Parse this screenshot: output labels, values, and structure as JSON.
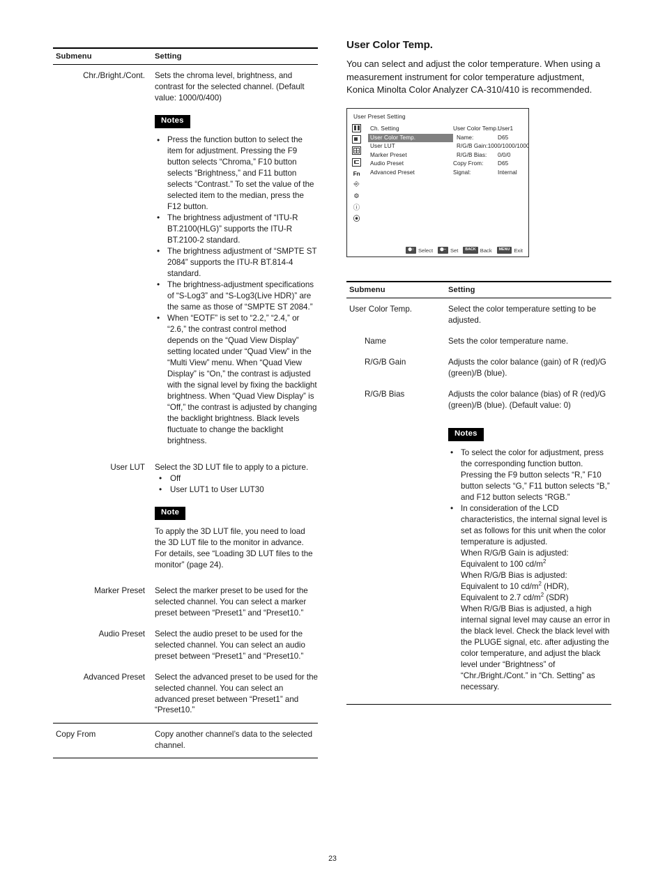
{
  "page_number": "23",
  "left_table": {
    "headers": {
      "submenu": "Submenu",
      "setting": "Setting"
    },
    "rows": {
      "chr_bright_cont": {
        "submenu": "Chr./Bright./Cont.",
        "setting": "Sets the chroma level, brightness, and contrast for the selected channel. (Default value: 1000/0/400)",
        "notes_label": "Notes",
        "notes": [
          "Press the function button to select the item for adjustment. Pressing the F9 button selects “Chroma,” F10 button selects “Brightness,” and F11 button selects “Contrast.” To set the value of the selected item to the median, press the F12 button.",
          "The brightness adjustment of “ITU-R BT.2100(HLG)” supports the ITU-R BT.2100-2 standard.",
          "The brightness adjustment of “SMPTE ST 2084” supports the ITU-R BT.814-4 standard.",
          "The brightness-adjustment specifications of “S-Log3” and “S-Log3(Live HDR)” are the same as those of “SMPTE ST 2084.”",
          "When “EOTF” is set to “2.2,” “2.4,” or “2.6,” the contrast control method depends on the “Quad View Display” setting located under “Quad View” in the “Multi View” menu. When “Quad View Display” is “On,” the contrast is adjusted with the signal level by fixing the backlight brightness. When “Quad View Display” is “Off,” the contrast is adjusted by changing the backlight brightness. Black levels fluctuate to change the backlight brightness."
        ]
      },
      "user_lut": {
        "submenu": "User LUT",
        "setting": "Select the 3D LUT file to apply to a picture.",
        "options": [
          "Off",
          "User LUT1 to User LUT30"
        ],
        "note_label": "Note",
        "note_body": "To apply the 3D LUT file, you need to load the 3D LUT file to the monitor in advance. For details, see “Loading 3D LUT files to the monitor” (page 24)."
      },
      "marker_preset": {
        "submenu": "Marker Preset",
        "setting": "Select the marker preset to be used for the selected channel. You can select a marker preset between “Preset1” and “Preset10.”"
      },
      "audio_preset": {
        "submenu": "Audio Preset",
        "setting": "Select the audio preset to be used for the selected channel. You can select an audio preset between “Preset1” and “Preset10.”"
      },
      "advanced_preset": {
        "submenu": "Advanced Preset",
        "setting": "Select the advanced preset to be used for the selected channel. You can select an advanced preset between “Preset1” and “Preset10.”"
      },
      "copy_from": {
        "submenu": "Copy From",
        "setting": "Copy another channel’s data to the selected channel."
      }
    }
  },
  "right_column": {
    "heading": "User Color Temp.",
    "intro": "You can select and adjust the color temperature. When using a measurement instrument for color temperature adjustment, Konica Minolta Color Analyzer CA-310/410 is recommended.",
    "osd": {
      "title": "User Preset Setting",
      "icons": [
        "person-icon",
        "picture-icon",
        "multiview-grid-icon",
        "level-icon",
        "fn-icon",
        "antenna-icon",
        "gear-icon",
        "prohibited-icon",
        "info-icon"
      ],
      "icon_fn_label": "Fn",
      "menu_items": [
        {
          "label": "Ch. Setting",
          "selected": false
        },
        {
          "label": "User Color Temp.",
          "selected": true
        },
        {
          "label": "User LUT",
          "selected": false
        },
        {
          "label": "Marker Preset",
          "selected": false
        },
        {
          "label": "Audio Preset",
          "selected": false
        },
        {
          "label": "Advanced Preset",
          "selected": false
        }
      ],
      "fields": [
        {
          "key": "User Color Temp.:",
          "value": "User1",
          "indent": false
        },
        {
          "key": "Name:",
          "value": "D65",
          "indent": true
        },
        {
          "key": "R/G/B Gain:",
          "value": "1000/1000/1000",
          "indent": true
        },
        {
          "key": "R/G/B Bias:",
          "value": "0/0/0",
          "indent": true
        },
        {
          "key": "Copy From:",
          "value": "D65",
          "indent": false
        },
        {
          "key": "Signal:",
          "value": "Internal",
          "indent": false
        }
      ],
      "status_bar": [
        {
          "badge": "⬤↕",
          "label": "Select"
        },
        {
          "badge": "⬤–",
          "label": "Set"
        },
        {
          "badge": "BACK",
          "label": "Back"
        },
        {
          "badge": "MENU",
          "label": "Exit"
        }
      ]
    },
    "table": {
      "headers": {
        "submenu": "Submenu",
        "setting": "Setting"
      },
      "rows": [
        {
          "submenu": "User Color Temp.",
          "setting": "Select the color temperature setting to be adjusted.",
          "indent": 0
        },
        {
          "submenu": "Name",
          "setting": "Sets the color temperature name.",
          "indent": 1
        },
        {
          "submenu": "R/G/B Gain",
          "setting": "Adjusts the color balance (gain) of R (red)/G (green)/B (blue).",
          "indent": 1
        },
        {
          "submenu": "R/G/B Bias",
          "setting": "Adjusts the color balance (bias) of R (red)/G (green)/B (blue). (Default value: 0)",
          "indent": 1
        }
      ]
    },
    "notes_label": "Notes",
    "notes": [
      "To select the color for adjustment, press the corresponding function button. Pressing the F9 button selects “R,” F10 button selects “G,” F11 button selects “B,” and F12 button selects “RGB.”"
    ],
    "note_lcd_lines": [
      "In consideration of the LCD characteristics, the internal signal level is set as follows for this unit when the color temperature is adjusted.",
      "When R/G/B Gain is adjusted:",
      "Equivalent to 100 cd/m²",
      "When R/G/B Bias is adjusted:",
      "Equivalent to 10 cd/m² (HDR),",
      "Equivalent to 2.7 cd/m² (SDR)",
      "When R/G/B Bias is adjusted, a high internal signal level may cause an error in the black level. Check the black level with the PLUGE signal, etc. after adjusting the color temperature, and adjust the black level under “Brightness” of “Chr./Bright./Cont.” in “Ch. Setting” as necessary."
    ]
  }
}
